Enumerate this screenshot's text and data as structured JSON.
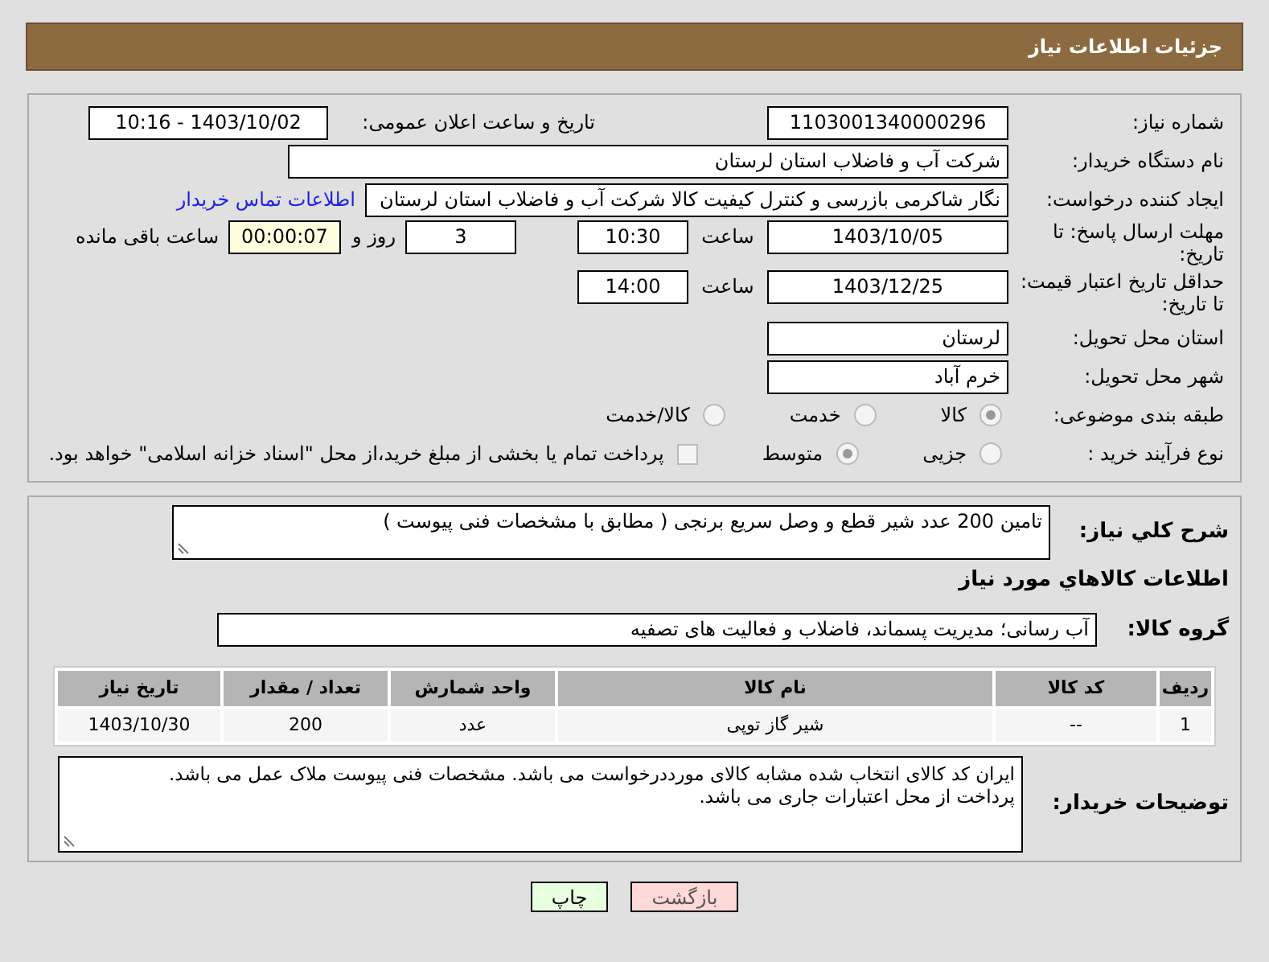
{
  "header": {
    "title": "جزئیات اطلاعات نیاز"
  },
  "details": {
    "need_number": {
      "label": "شماره نیاز:",
      "value": "1103001340000296"
    },
    "announce": {
      "label": "تاریخ و ساعت اعلان عمومی:",
      "value": "1403/10/02 - 10:16"
    },
    "buyer": {
      "label": "نام دستگاه خریدار:",
      "value": "شرکت آب و فاضلاب استان لرستان"
    },
    "creator": {
      "label": "ایجاد کننده درخواست:",
      "value": "نگار شاکرمی بازرسی و کنترل کیفیت کالا شرکت آب و فاضلاب استان لرستان",
      "link": "اطلاعات تماس خریدار"
    },
    "deadline": {
      "label": "مهلت ارسال پاسخ: تا تاریخ:",
      "date": "1403/10/05",
      "time_label": "ساعت",
      "time": "10:30",
      "days": "3",
      "days_label": "روز و",
      "remaining": "00:00:07",
      "remaining_label": "ساعت باقی مانده"
    },
    "validity": {
      "label": "حداقل تاریخ اعتبار قیمت: تا تاریخ:",
      "date": "1403/12/25",
      "time_label": "ساعت",
      "time": "14:00"
    },
    "province": {
      "label": "استان محل تحویل:",
      "value": "لرستان"
    },
    "city": {
      "label": "شهر محل تحویل:",
      "value": "خرم آباد"
    },
    "category": {
      "label": "طبقه بندی موضوعی:",
      "options": [
        {
          "label": "کالا",
          "selected": true
        },
        {
          "label": "خدمت",
          "selected": false
        },
        {
          "label": "کالا/خدمت",
          "selected": false
        }
      ]
    },
    "process": {
      "label": "نوع فرآیند خرید :",
      "options": [
        {
          "label": "جزیی",
          "selected": false
        },
        {
          "label": "متوسط",
          "selected": true
        }
      ],
      "payment": {
        "checked": false,
        "text": "پرداخت تمام یا بخشی از مبلغ خرید،از محل \"اسناد خزانه اسلامی\" خواهد بود."
      }
    }
  },
  "goods": {
    "summary": {
      "label": "شرح کلي نياز:",
      "value": "تامین 200 عدد شیر قطع و وصل سریع برنجی ( مطابق با مشخصات فنی پیوست )"
    },
    "section_title": "اطلاعات كالاهاي مورد نياز",
    "group": {
      "label": "گروه کالا:",
      "value": "آب رسانی؛ مدیریت پسماند، فاضلاب و فعالیت های تصفیه"
    },
    "table": {
      "columns": [
        "ردیف",
        "کد کالا",
        "نام کالا",
        "واحد شمارش",
        "تعداد / مقدار",
        "تاریخ نیاز"
      ],
      "rows": [
        [
          "1",
          "--",
          "شیر گاز توپی",
          "عدد",
          "200",
          "1403/10/30"
        ]
      ]
    },
    "notes": {
      "label": "توضیحات خریدار:",
      "value": "ایران کد کالای انتخاب شده مشابه کالای مورددرخواست می باشد. مشخصات فنی پیوست ملاک عمل می باشد.\nپرداخت از محل اعتبارات جاری می باشد."
    }
  },
  "buttons": [
    {
      "label": "بازگشت",
      "kind": "back"
    },
    {
      "label": "چاپ",
      "kind": "print"
    }
  ]
}
